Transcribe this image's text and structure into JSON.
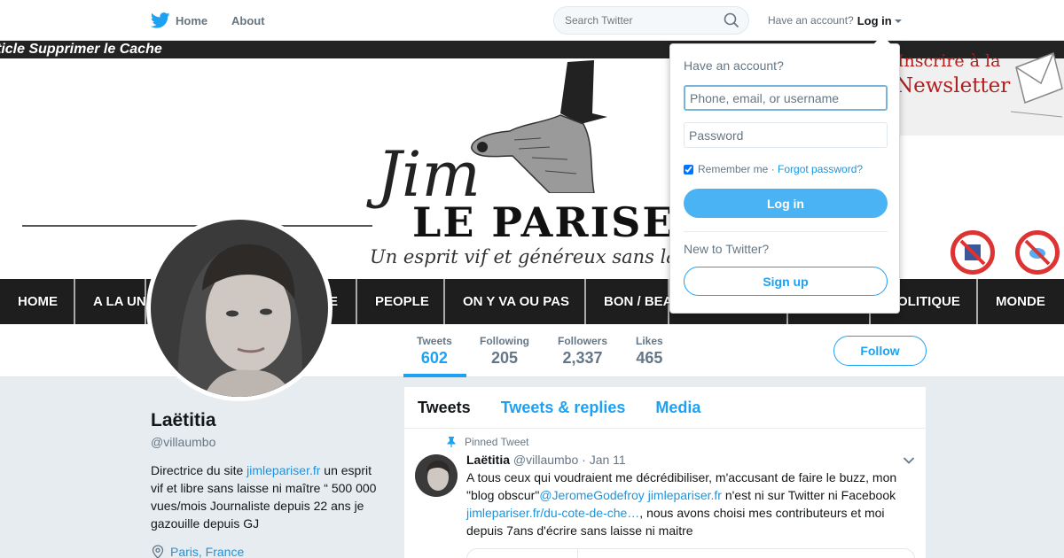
{
  "nav": {
    "home_label": "Home",
    "about_label": "About",
    "search_placeholder": "Search Twitter",
    "have_account": "Have an account?",
    "login_label": "Log in"
  },
  "banner": {
    "top_strip": "ticle   Supprimer le Cache",
    "jim": "Jim",
    "title": "LE PARISE",
    "slogan": "Un esprit vif et généreux sans laisse",
    "newsletter_a": "Inscrire à la",
    "newsletter_b": "Newsletter",
    "menu": [
      "HOME",
      "A LA UN",
      "E",
      "PEOPLE",
      "ON Y VA OU PAS",
      "BON / BEA",
      "",
      "",
      "POLITIQUE",
      "MONDE"
    ]
  },
  "stats": {
    "tweets_label": "Tweets",
    "tweets_value": "602",
    "following_label": "Following",
    "following_value": "205",
    "followers_label": "Followers",
    "followers_value": "2,337",
    "likes_label": "Likes",
    "likes_value": "465",
    "follow_button": "Follow"
  },
  "profile": {
    "name": "Laëtitia",
    "handle": "@villaumbo",
    "bio_prefix": "Directrice du site ",
    "bio_link": "jimlepariser.fr",
    "bio_suffix": " un esprit vif et libre sans laisse ni maître “ 500 000 vues/mois Journaliste depuis 22 ans je gazouille depuis GJ",
    "location": "Paris, France"
  },
  "timeline": {
    "tab_tweets": "Tweets",
    "tab_replies": "Tweets & replies",
    "tab_media": "Media",
    "pinned_label": "Pinned Tweet",
    "tweet": {
      "name": "Laëtitia",
      "handle": "@villaumbo",
      "date": "Jan 11",
      "text_1": "A tous ceux qui voudraient me décrédibiliser, m'accusant de faire le buzz, mon \"blog obscur\"",
      "mention": "@JeromeGodefroy",
      "link_1": "jimlepariser.fr",
      "text_2": " n'est ni sur Twitter ni Facebook ",
      "link_2": "jimlepariser.fr/du-cote-de-che…",
      "text_3": ", nous avons choisi mes contributeurs et moi depuis 7ans d'écrire sans laisse ni maitre"
    }
  },
  "dropdown": {
    "title": "Have an account?",
    "username_placeholder": "Phone, email, or username",
    "password_placeholder": "Password",
    "remember_me": "Remember me",
    "separator": " · ",
    "forgot_password": "Forgot password?",
    "login_button": "Log in",
    "new_to_twitter": "New to Twitter?",
    "signup_button": "Sign up"
  },
  "colors": {
    "accent": "#1da1f2",
    "login_button": "#4ab3f4",
    "background": "#e6ecf0"
  }
}
